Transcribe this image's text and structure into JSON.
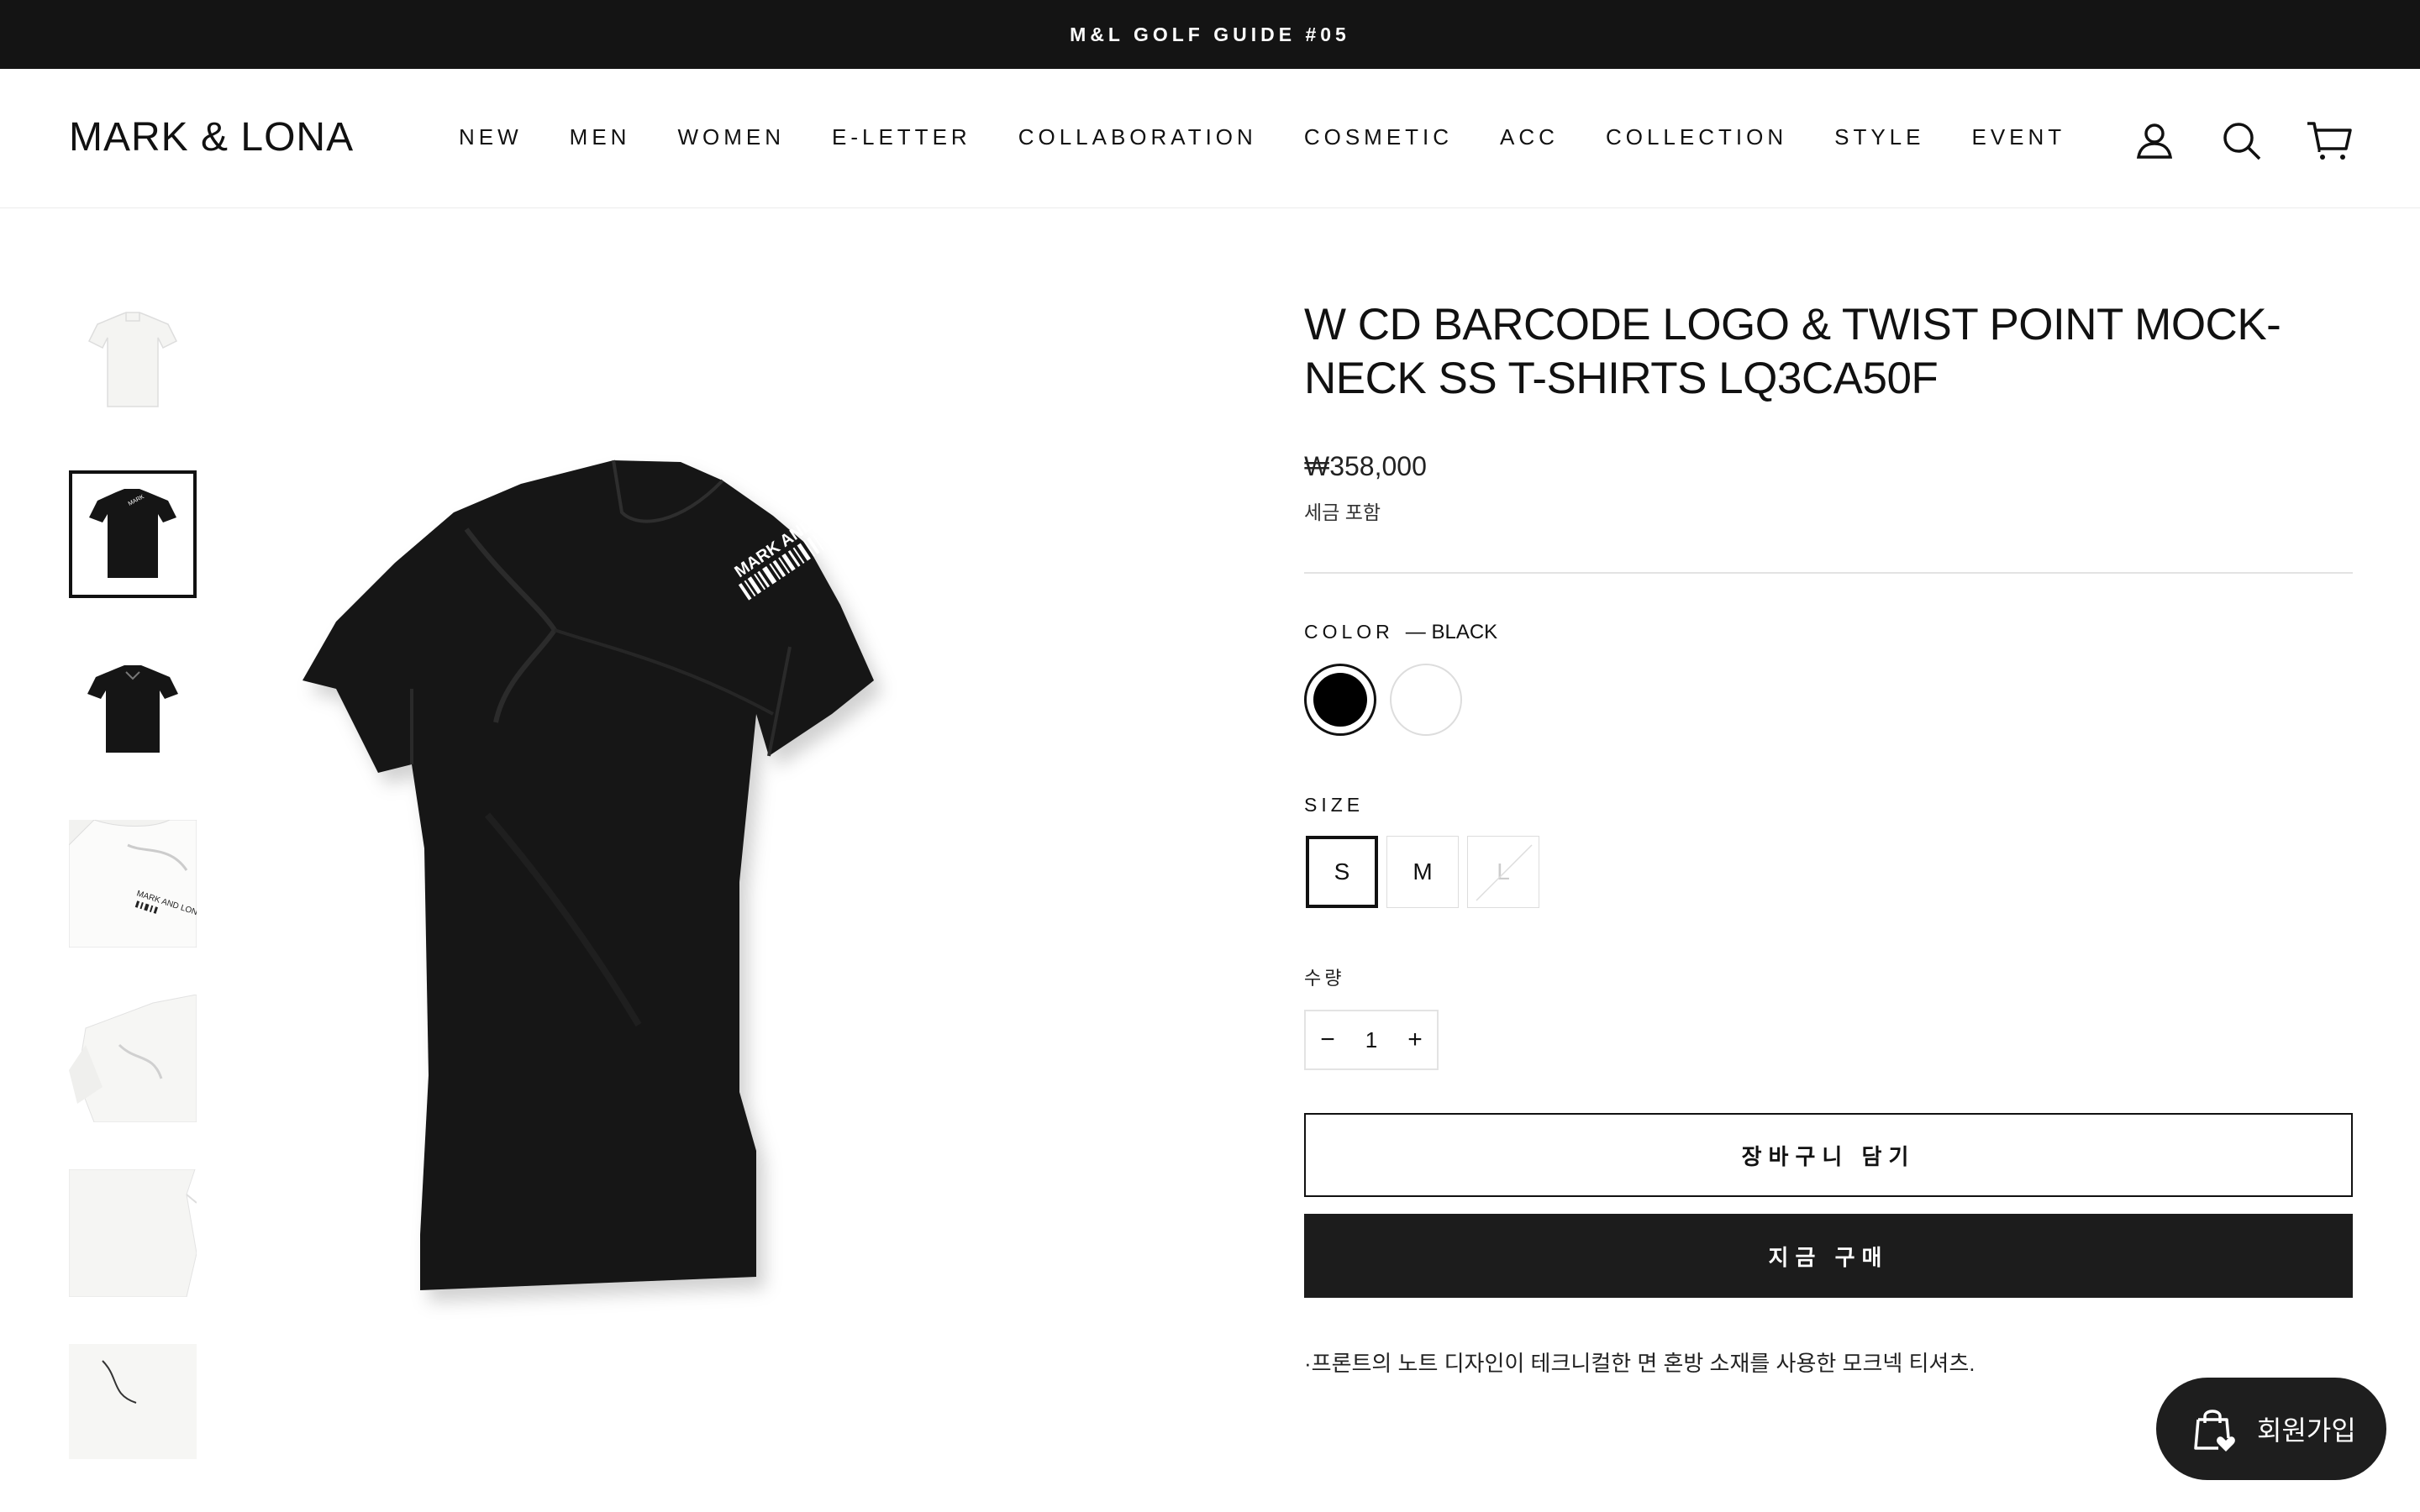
{
  "announcement": {
    "text": "M&L GOLF GUIDE #05"
  },
  "header": {
    "logo": "MARK & LONA",
    "nav": [
      "NEW",
      "MEN",
      "WOMEN",
      "E-LETTER",
      "COLLABORATION",
      "COSMETIC",
      "ACC",
      "COLLECTION",
      "STYLE",
      "EVENT"
    ],
    "icons": [
      "account-icon",
      "search-icon",
      "cart-icon"
    ]
  },
  "gallery": {
    "thumbnails": [
      {
        "color": "white",
        "view": "front",
        "active": false
      },
      {
        "color": "black",
        "view": "front",
        "active": true
      },
      {
        "color": "black",
        "view": "back",
        "active": false
      },
      {
        "color": "white",
        "view": "neck-detail",
        "active": false
      },
      {
        "color": "white",
        "view": "twist-detail",
        "active": false
      },
      {
        "color": "white",
        "view": "hem-detail",
        "active": false
      },
      {
        "color": "white",
        "view": "detail",
        "active": false
      }
    ],
    "main_image": {
      "color": "black",
      "print": "MARK AND LONA"
    }
  },
  "product": {
    "title": "W CD BARCODE LOGO & TWIST POINT MOCK-NECK SS T-SHIRTS LQ3CA50F",
    "price": "₩358,000",
    "tax_note": "세금 포함",
    "color_label": "COLOR",
    "color_selected": "— BLACK",
    "colors": [
      {
        "name": "BLACK",
        "hex": "#000000",
        "selected": true
      },
      {
        "name": "WHITE",
        "hex": "#ffffff",
        "selected": false
      }
    ],
    "size_label": "SIZE",
    "sizes": [
      {
        "label": "S",
        "selected": true,
        "available": true
      },
      {
        "label": "M",
        "selected": false,
        "available": true
      },
      {
        "label": "L",
        "selected": false,
        "available": false
      }
    ],
    "quantity_label": "수량",
    "quantity": "1",
    "qty_minus": "−",
    "qty_plus": "+",
    "add_to_cart": "장바구니 담기",
    "buy_now": "지금 구매",
    "description": "·프론트의 노트 디자인이 테크니컬한 면 혼방 소재를 사용한 모크넥 티셔츠."
  },
  "signup_button": {
    "label": "회원가입"
  }
}
